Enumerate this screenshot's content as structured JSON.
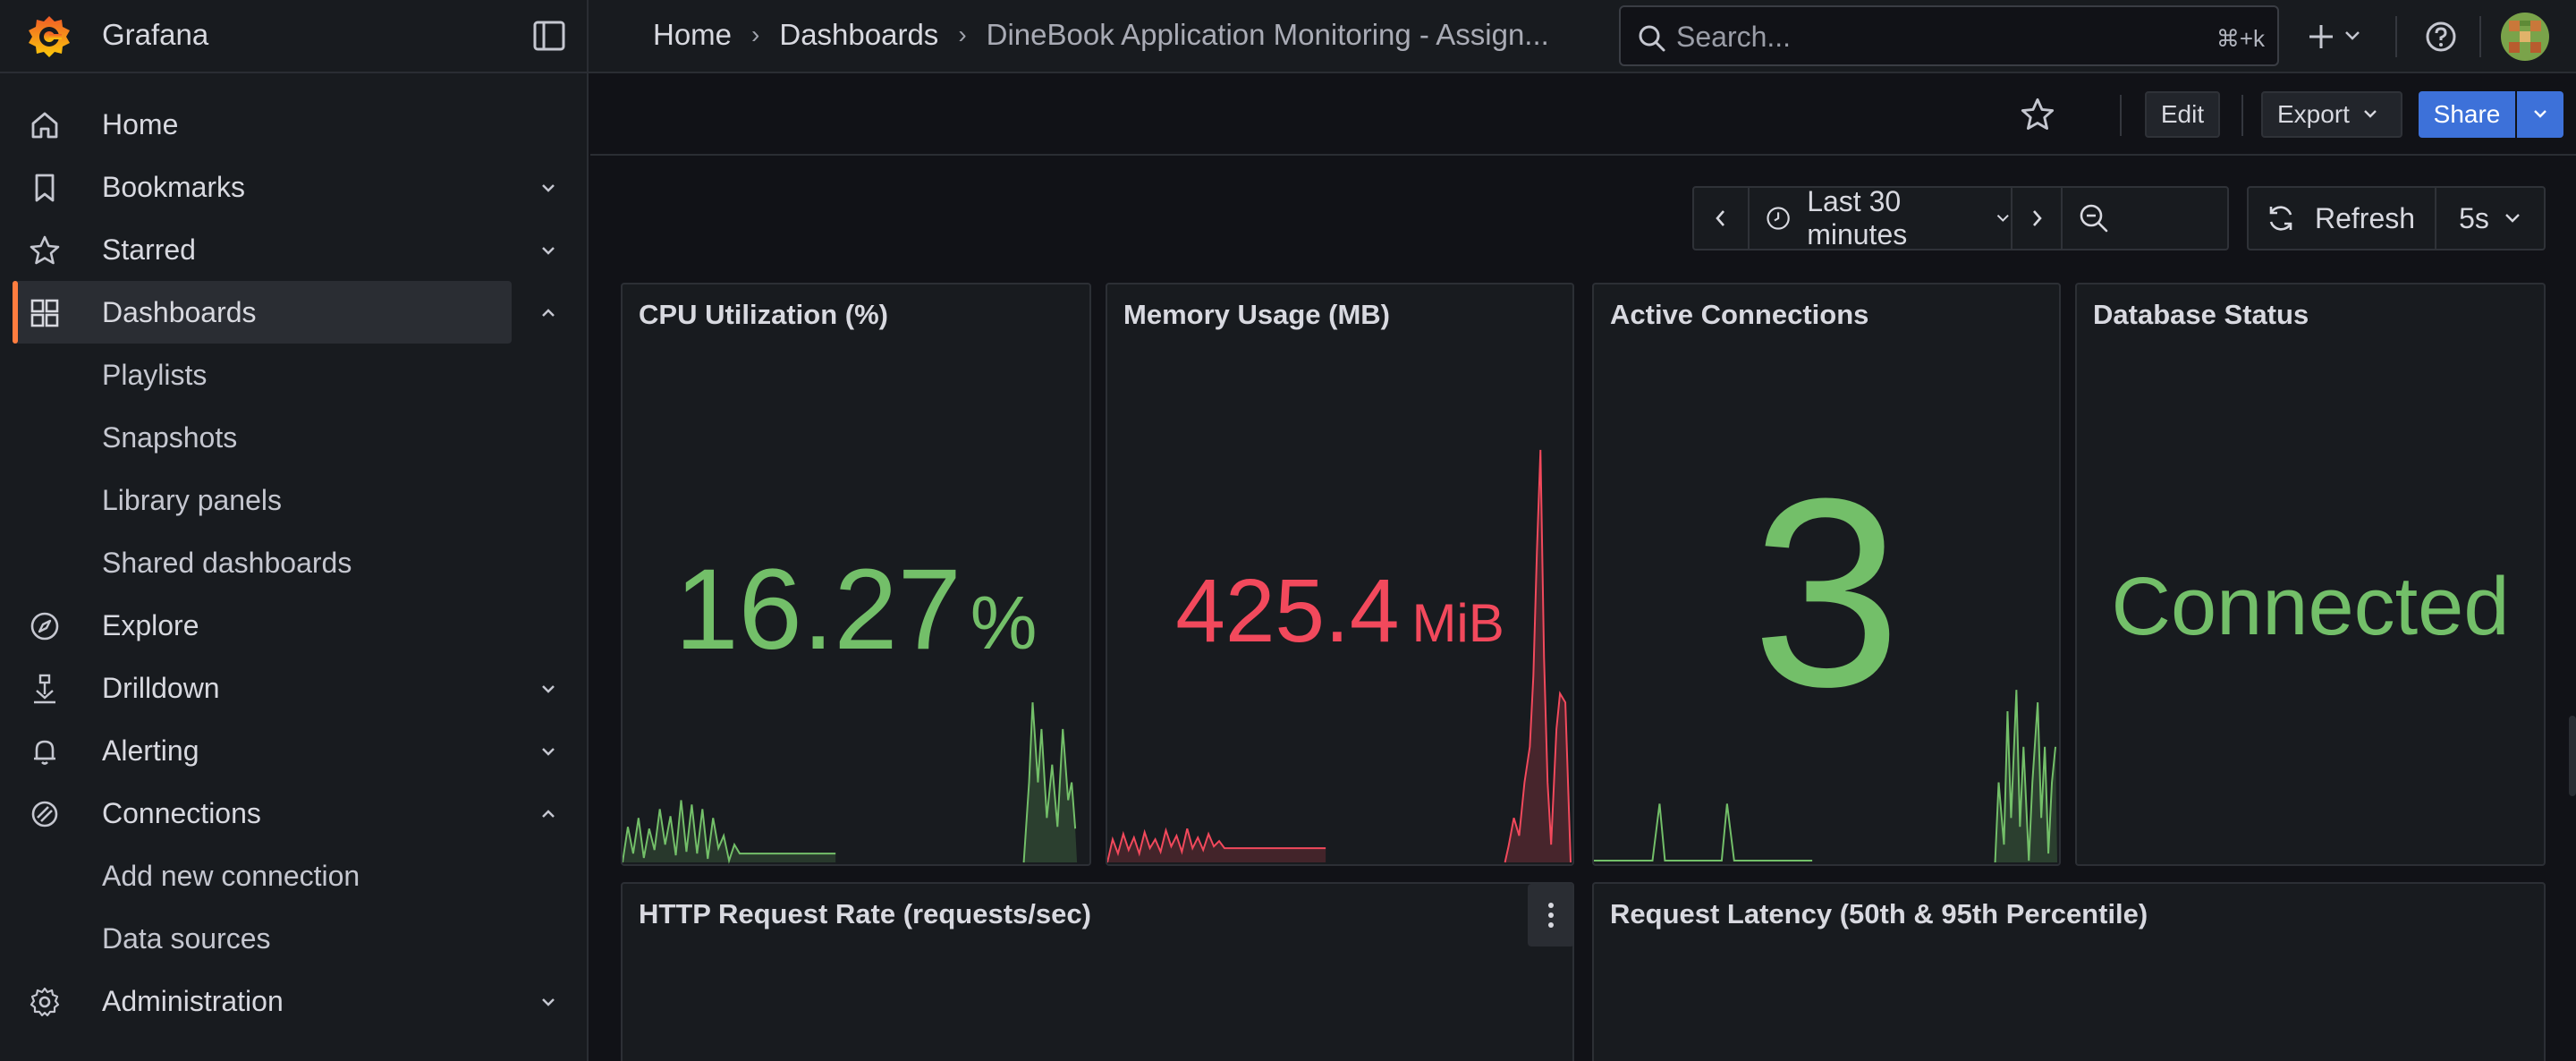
{
  "app": {
    "name": "Grafana"
  },
  "breadcrumb": {
    "home": "Home",
    "dashboards": "Dashboards",
    "current": "DineBook Application Monitoring - Assign..."
  },
  "search": {
    "placeholder": "Search...",
    "shortcut": "⌘+k"
  },
  "toolbar": {
    "edit_label": "Edit",
    "export_label": "Export",
    "share_label": "Share"
  },
  "time_picker": {
    "range": "Last 30 minutes",
    "refresh_label": "Refresh",
    "refresh_interval": "5s"
  },
  "sidebar": {
    "items": [
      {
        "label": "Home",
        "icon": "home-icon"
      },
      {
        "label": "Bookmarks",
        "icon": "bookmark-icon",
        "expandable": true
      },
      {
        "label": "Starred",
        "icon": "star-icon",
        "expandable": true
      },
      {
        "label": "Dashboards",
        "icon": "dashboards-icon",
        "expanded": true,
        "active": true
      },
      {
        "label": "Playlists",
        "sub": true
      },
      {
        "label": "Snapshots",
        "sub": true
      },
      {
        "label": "Library panels",
        "sub": true
      },
      {
        "label": "Shared dashboards",
        "sub": true
      },
      {
        "label": "Explore",
        "icon": "compass-icon"
      },
      {
        "label": "Drilldown",
        "icon": "drilldown-icon",
        "expandable": true
      },
      {
        "label": "Alerting",
        "icon": "bell-icon",
        "expandable": true
      },
      {
        "label": "Connections",
        "icon": "connections-icon",
        "expanded": true
      },
      {
        "label": "Add new connection",
        "sub": true
      },
      {
        "label": "Data sources",
        "sub": true
      },
      {
        "label": "Administration",
        "icon": "gear-icon",
        "expandable": true
      }
    ]
  },
  "panels": {
    "cpu": {
      "title": "CPU Utilization (%)",
      "value": "16.27",
      "unit": "%",
      "color": "#73bf69"
    },
    "memory": {
      "title": "Memory Usage (MB)",
      "value": "425.4",
      "unit": "MiB",
      "color": "#f2495c"
    },
    "connections": {
      "title": "Active Connections",
      "value": "3",
      "color": "#73bf69"
    },
    "db": {
      "title": "Database Status",
      "value": "Connected",
      "color": "#73bf69"
    },
    "http": {
      "title": "HTTP Request Rate (requests/sec)"
    },
    "latency": {
      "title": "Request Latency (50th & 95th Percentile)"
    }
  },
  "colors": {
    "accent": "#ff7d3f",
    "primary": "#3d71d9",
    "green": "#73bf69",
    "red": "#f2495c"
  }
}
